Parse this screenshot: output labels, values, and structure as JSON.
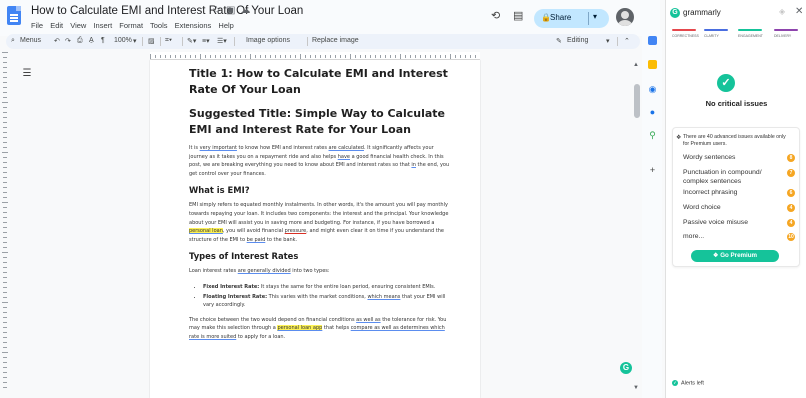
{
  "titlebar": {
    "doc_title": "How to Calculate EMI and Interest Rate Of Your Loan",
    "menus": [
      "File",
      "Edit",
      "View",
      "Insert",
      "Format",
      "Tools",
      "Extensions",
      "Help"
    ],
    "share_label": "Share"
  },
  "toolbar": {
    "menus_label": "Menus",
    "zoom": "100%",
    "image_options": "Image options",
    "replace_image": "Replace image",
    "mode": "Editing"
  },
  "document": {
    "title1": "Title 1: How to Calculate EMI and Interest Rate Of Your Loan",
    "title2": "Suggested Title: Simple Way to Calculate EMI and Interest Rate for Your Loan",
    "intro": {
      "p1": "It is ",
      "u1": "very important",
      "p2": " to know how EMI and interest rates ",
      "u2": "are calculated",
      "p3": ". It significantly affects your journey as it takes you on a repayment ride and also helps ",
      "u3": "have",
      "p4": " a good financial health check. In this post, we are breaking everything you need to know about EMI and interest rates so that ",
      "u4": "in",
      "p5": " the end, you get control over your finances."
    },
    "h_emi": "What is EMI?",
    "emi": {
      "p1": "EMI simply refers to equated monthly instalments. In other words, it's the amount you will pay monthly towards repaying your loan. It includes two components: the interest and the principal. Your knowledge about your EMI will assist you in saving more and budgeting. For instance, if you have borrowed a ",
      "hl1": "personal loan",
      "p2": ", you will avoid financial ",
      "e1": "pressure",
      "p3": ", and might even clear it on time if you understand the structure of the EMI to ",
      "u1": "be paid",
      "p4": " to the bank."
    },
    "h_types": "Types of Interest Rates",
    "types": {
      "p1": "Loan interest rates ",
      "u1": "are generally divided",
      "p2": " into two types:"
    },
    "bullets": {
      "fixed_label": "Fixed Interest Rate:",
      "fixed_text": " It stays the same for the entire loan period, ensuring consistent EMIs.",
      "float_label": "Floating Interest Rate:",
      "float_text1": " This varies with the market conditions, ",
      "float_u": "which means",
      "float_text2": " that your EMI will vary accordingly."
    },
    "choice": {
      "p1": "The choice between the two would depend on financial conditions ",
      "u1": "as well as",
      "p2": " the tolerance for risk. You may make this selection through a ",
      "hl1": "personal loan app",
      "p3": " that helps ",
      "u2": "compare as well as determines which rate is more suited",
      "p4": " to apply for a loan."
    }
  },
  "grammarly": {
    "name": "grammarly",
    "categories": [
      {
        "label": "CORRECTNESS",
        "color": "#e5484d"
      },
      {
        "label": "CLARITY",
        "color": "#4a6ee0"
      },
      {
        "label": "ENGAGEMENT",
        "color": "#15c39a"
      },
      {
        "label": "DELIVERY",
        "color": "#8e44ad"
      }
    ],
    "no_issues": "No critical issues",
    "advanced": "There are 40 advanced issues available only for Premium users.",
    "issues": [
      {
        "label": "Wordy sentences",
        "count": "8"
      },
      {
        "label": "Punctuation in compound/ complex sentences",
        "count": "7"
      },
      {
        "label": "Incorrect phrasing",
        "count": "6"
      },
      {
        "label": "Word choice",
        "count": "4"
      },
      {
        "label": "Passive voice misuse",
        "count": "4"
      },
      {
        "label": "more...",
        "count": "10"
      }
    ],
    "premium": "Go Premium",
    "alerts": "Alerts left"
  }
}
